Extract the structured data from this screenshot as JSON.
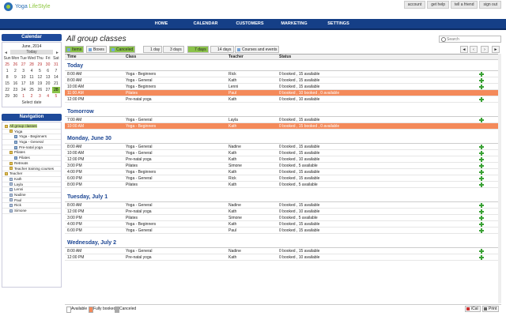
{
  "logo": {
    "brand": "Yoga ",
    "brand2": "LifeStyle"
  },
  "toplinks": [
    "account",
    "get help",
    "tell a friend",
    "sign out"
  ],
  "nav": [
    "HOME",
    "CALENDAR",
    "CUSTOMERS",
    "MARKETING",
    "SETTINGS"
  ],
  "calendar": {
    "title": "Calendar",
    "month": "June, 2014",
    "today_label": "Today",
    "weekdays": [
      "Sun",
      "Mon",
      "Tue",
      "Wed",
      "Thu",
      "Fri",
      "Sat"
    ],
    "weeks": [
      [
        "25",
        "26",
        "27",
        "28",
        "29",
        "30",
        "31"
      ],
      [
        "1",
        "2",
        "3",
        "4",
        "5",
        "6",
        "7"
      ],
      [
        "8",
        "9",
        "10",
        "11",
        "12",
        "13",
        "14"
      ],
      [
        "15",
        "16",
        "17",
        "18",
        "19",
        "20",
        "21"
      ],
      [
        "22",
        "23",
        "24",
        "25",
        "26",
        "27",
        "28"
      ],
      [
        "29",
        "30",
        "1",
        "2",
        "3",
        "4",
        "5"
      ]
    ],
    "select_label": "Select date"
  },
  "navigation": {
    "title": "Navigation",
    "items": [
      {
        "label": "All group classes",
        "icon": "folder",
        "indent": 0,
        "hl": true
      },
      {
        "label": "Yoga",
        "icon": "folder",
        "indent": 1
      },
      {
        "label": "Yoga - Beginners",
        "icon": "doc",
        "indent": 2
      },
      {
        "label": "Yoga - General",
        "icon": "doc",
        "indent": 2
      },
      {
        "label": "Pre-natal yoga",
        "icon": "doc",
        "indent": 2
      },
      {
        "label": "Pilates",
        "icon": "folder",
        "indent": 1
      },
      {
        "label": "Pilates",
        "icon": "doc",
        "indent": 2
      },
      {
        "label": "Retreats",
        "icon": "folder",
        "indent": 1
      },
      {
        "label": "Teacher training courses",
        "icon": "folder",
        "indent": 1
      },
      {
        "label": "Teacher",
        "icon": "folder",
        "indent": 0
      },
      {
        "label": "Kath",
        "icon": "user",
        "indent": 1
      },
      {
        "label": "Layla",
        "icon": "user",
        "indent": 1
      },
      {
        "label": "Lenni",
        "icon": "user",
        "indent": 1
      },
      {
        "label": "Nadine",
        "icon": "user",
        "indent": 1
      },
      {
        "label": "Paul",
        "icon": "user",
        "indent": 1
      },
      {
        "label": "Rick",
        "icon": "user",
        "indent": 1
      },
      {
        "label": "Simone",
        "icon": "user",
        "indent": 1
      }
    ]
  },
  "main": {
    "title": "All group classes",
    "search_placeholder": "Search",
    "toolbar": [
      "Items",
      "Boxes",
      "Canceled",
      "1 day",
      "3 days",
      "7 days",
      "14 days",
      "Courses and events"
    ],
    "columns": [
      "Time",
      "Class",
      "Teacher",
      "Status"
    ],
    "days": [
      {
        "label": "Today",
        "rows": [
          [
            "8:00 AM",
            "Yoga - Beginners",
            "Rick",
            "0 booked , 15 available",
            false
          ],
          [
            "8:00 AM",
            "Yoga - General",
            "Kath",
            "0 booked , 15 available",
            false
          ],
          [
            "10:00 AM",
            "Yoga - Beginners",
            "Lenni",
            "0 booked , 15 available",
            false
          ],
          [
            "11:00 AM",
            "Pilates",
            "Paul",
            "0 booked , 10 booked , 0 available",
            true
          ],
          [
            "12:00 PM",
            "Pre-natal yoga",
            "Kath",
            "0 booked , 10 available",
            false
          ]
        ]
      },
      {
        "label": "Tomorrow",
        "rows": [
          [
            "7:00 AM",
            "Yoga - General",
            "Layla",
            "0 booked , 15 available",
            false
          ],
          [
            "10:00 AM",
            "Yoga - Beginners",
            "Kath",
            "0 booked , 15 booked , 0 available",
            true
          ]
        ]
      },
      {
        "label": "Monday, June 30",
        "rows": [
          [
            "8:00 AM",
            "Yoga - General",
            "Nadine",
            "0 booked , 15 available",
            false
          ],
          [
            "10:00 AM",
            "Yoga - General",
            "Kath",
            "0 booked , 15 available",
            false
          ],
          [
            "12:00 PM",
            "Pre-natal yoga",
            "Kath",
            "0 booked , 10 available",
            false
          ],
          [
            "3:00 PM",
            "Pilates",
            "Simone",
            "0 booked , 5 available",
            false
          ],
          [
            "4:00 PM",
            "Yoga - Beginners",
            "Kath",
            "0 booked , 15 available",
            false
          ],
          [
            "6:00 PM",
            "Yoga - General",
            "Rick",
            "0 booked , 15 available",
            false
          ],
          [
            "8:00 PM",
            "Pilates",
            "Kath",
            "0 booked , 5 available",
            false
          ]
        ]
      },
      {
        "label": "Tuesday, July 1",
        "rows": [
          [
            "8:00 AM",
            "Yoga - General",
            "Nadine",
            "0 booked , 15 available",
            false
          ],
          [
            "12:00 PM",
            "Pre-natal yoga",
            "Kath",
            "0 booked , 10 available",
            false
          ],
          [
            "3:00 PM",
            "Pilates",
            "Simone",
            "0 booked , 5 available",
            false
          ],
          [
            "4:00 PM",
            "Yoga - Beginners",
            "Kath",
            "0 booked , 15 available",
            false
          ],
          [
            "6:00 PM",
            "Yoga - General",
            "Paul",
            "0 booked , 15 available",
            false
          ]
        ]
      },
      {
        "label": "Wednesday, July 2",
        "rows": [
          [
            "8:00 AM",
            "Yoga - General",
            "Nadine",
            "0 booked , 15 available",
            false
          ],
          [
            "12:00 PM",
            "Pre-natal yoga",
            "Kath",
            "0 booked , 10 available",
            false
          ]
        ]
      }
    ],
    "legend": [
      "Available",
      "Fully booked",
      "Canceled"
    ],
    "ical": "iCal",
    "print": "Print"
  },
  "colors": {
    "nav": "#153f87",
    "header": "#1e4a9a",
    "accent": "#8bc34a",
    "full": "#f48a5a",
    "day": "#1b4593"
  }
}
